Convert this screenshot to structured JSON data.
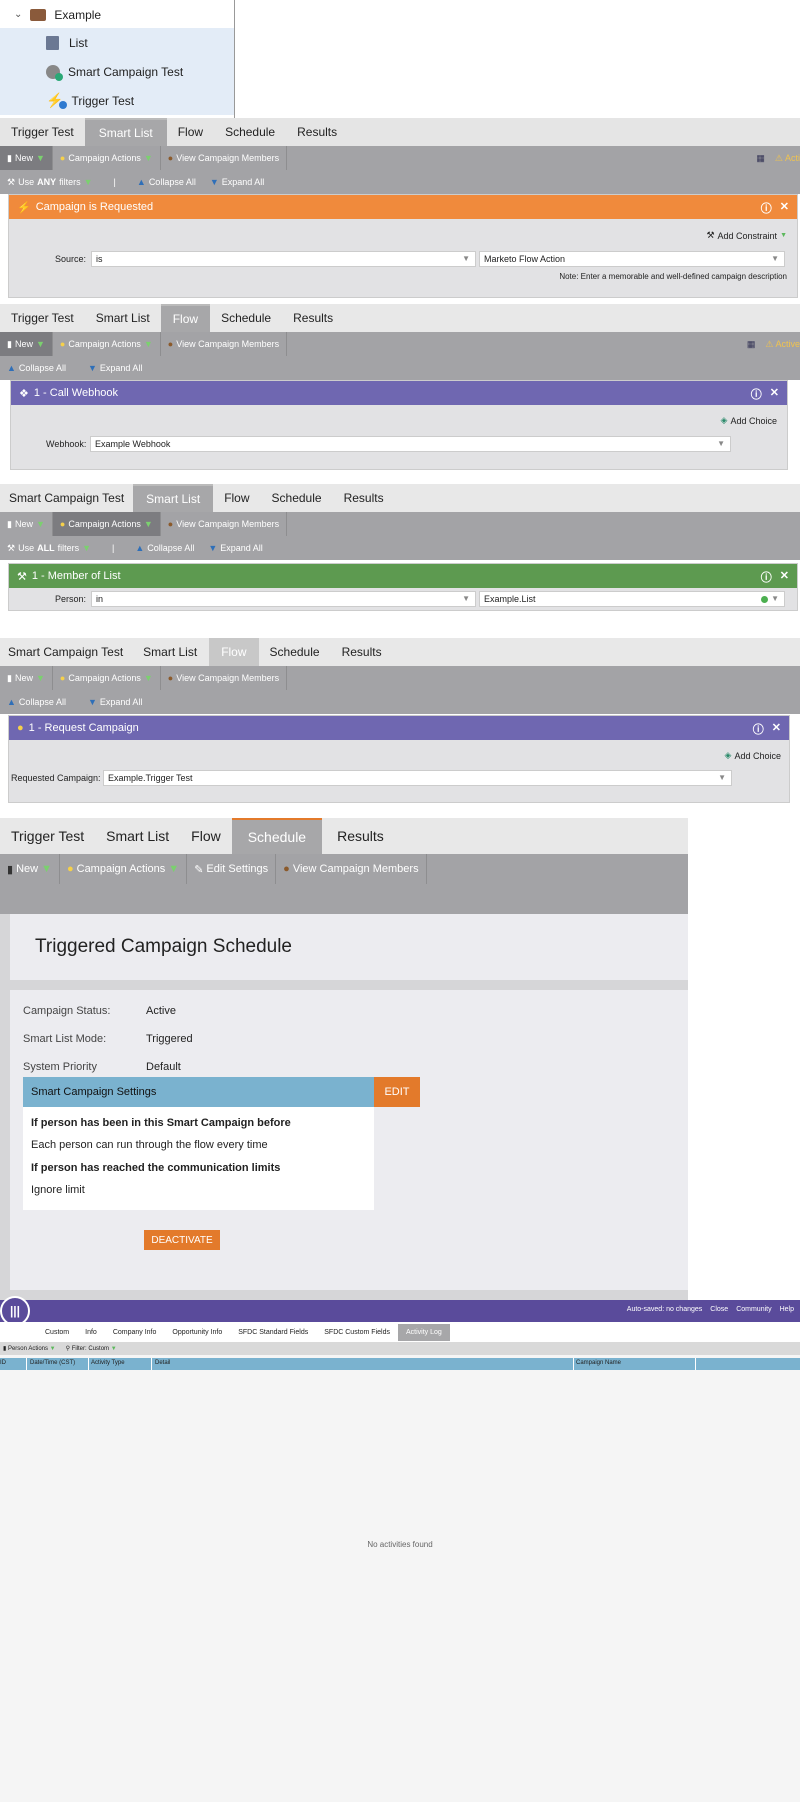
{
  "tree": {
    "root": "Example",
    "items": [
      {
        "label": "List",
        "icon": "list-icon"
      },
      {
        "label": "Smart Campaign Test",
        "icon": "smart-campaign-icon"
      },
      {
        "label": "Trigger Test",
        "icon": "trigger-campaign-icon"
      }
    ]
  },
  "section1": {
    "tabs": [
      "Trigger Test",
      "Smart List",
      "Flow",
      "Schedule",
      "Results"
    ],
    "toolbar": {
      "new": "New",
      "campaign_actions": "Campaign Actions",
      "view_members": "View Campaign Members",
      "activity": "Acti"
    },
    "filters": {
      "use_prefix": "Use",
      "use_bold": "ANY",
      "use_suffix": "filters",
      "sep": "|",
      "collapse": "Collapse All",
      "expand": "Expand All"
    },
    "trigger": {
      "title": "Campaign is Requested",
      "add_constraint": "Add Constraint",
      "source_label": "Source:",
      "operator": "is",
      "value": "Marketo Flow Action",
      "note": "Note: Enter a memorable and well-defined campaign description"
    }
  },
  "section2": {
    "tabs": [
      "Trigger Test",
      "Smart List",
      "Flow",
      "Schedule",
      "Results"
    ],
    "toolbar": {
      "new": "New",
      "campaign_actions": "Campaign Actions",
      "view_members": "View Campaign Members",
      "activity": "Active"
    },
    "filters": {
      "collapse": "Collapse All",
      "expand": "Expand All"
    },
    "step": {
      "title": "1 - Call Webhook",
      "add_choice": "Add Choice",
      "webhook_label": "Webhook:",
      "webhook_value": "Example Webhook"
    }
  },
  "section3": {
    "tabs": [
      "Smart Campaign Test",
      "Smart List",
      "Flow",
      "Schedule",
      "Results"
    ],
    "toolbar": {
      "new": "New",
      "campaign_actions": "Campaign Actions",
      "view_members": "View Campaign Members"
    },
    "filters": {
      "use_prefix": "Use",
      "use_bold": "ALL",
      "use_suffix": "filters",
      "sep": "|",
      "collapse": "Collapse All",
      "expand": "Expand All"
    },
    "filter": {
      "title": "1 - Member of List",
      "person_label": "Person:",
      "operator": "in",
      "value": "Example.List"
    }
  },
  "section4": {
    "tabs": [
      "Smart Campaign Test",
      "Smart List",
      "Flow",
      "Schedule",
      "Results"
    ],
    "toolbar": {
      "new": "New",
      "campaign_actions": "Campaign Actions",
      "view_members": "View Campaign Members"
    },
    "filters": {
      "collapse": "Collapse All",
      "expand": "Expand All"
    },
    "step": {
      "title": "1 - Request Campaign",
      "add_choice": "Add Choice",
      "label": "Requested Campaign:",
      "value": "Example.Trigger Test"
    }
  },
  "section5": {
    "tabs": [
      "Trigger Test",
      "Smart List",
      "Flow",
      "Schedule",
      "Results"
    ],
    "toolbar": {
      "new": "New",
      "campaign_actions": "Campaign Actions",
      "edit_settings": "Edit Settings",
      "view_members": "View Campaign Members"
    },
    "heading": "Triggered Campaign Schedule",
    "status_rows": [
      {
        "label": "Campaign Status:",
        "value": "Active"
      },
      {
        "label": "Smart List Mode:",
        "value": "Triggered"
      },
      {
        "label": "System Priority",
        "value": "Default"
      }
    ],
    "settings": {
      "title": "Smart Campaign Settings",
      "edit": "EDIT",
      "lines": [
        {
          "text": "If person has been in this Smart Campaign before",
          "bold": true
        },
        {
          "text": "Each person can run through the flow every time",
          "bold": false
        },
        {
          "text": "If person has reached the communication limits",
          "bold": true
        },
        {
          "text": "Ignore limit",
          "bold": false
        }
      ]
    },
    "deactivate": "DEACTIVATE"
  },
  "section6": {
    "header_links": [
      "Auto-saved: no changes",
      "Close",
      "Community",
      "Help"
    ],
    "tabs": [
      "Custom",
      "Info",
      "Company Info",
      "Opportunity Info",
      "SFDC Standard Fields",
      "SFDC Custom Fields",
      "Activity Log"
    ],
    "toolbar": {
      "person_actions": "Person Actions",
      "filter": "Filter: Custom"
    },
    "columns": [
      "ID",
      "Date/Time (CST)",
      "Activity Type",
      "Detail",
      "Campaign Name"
    ],
    "empty": "No activities found"
  },
  "colors": {
    "orange": "#f08a3c",
    "purple": "#6f67b1",
    "green": "#5d9a50",
    "blue_header": "#7ab2cf",
    "edit_orange": "#e37a2b",
    "marketo_purple": "#5a4b9b"
  }
}
